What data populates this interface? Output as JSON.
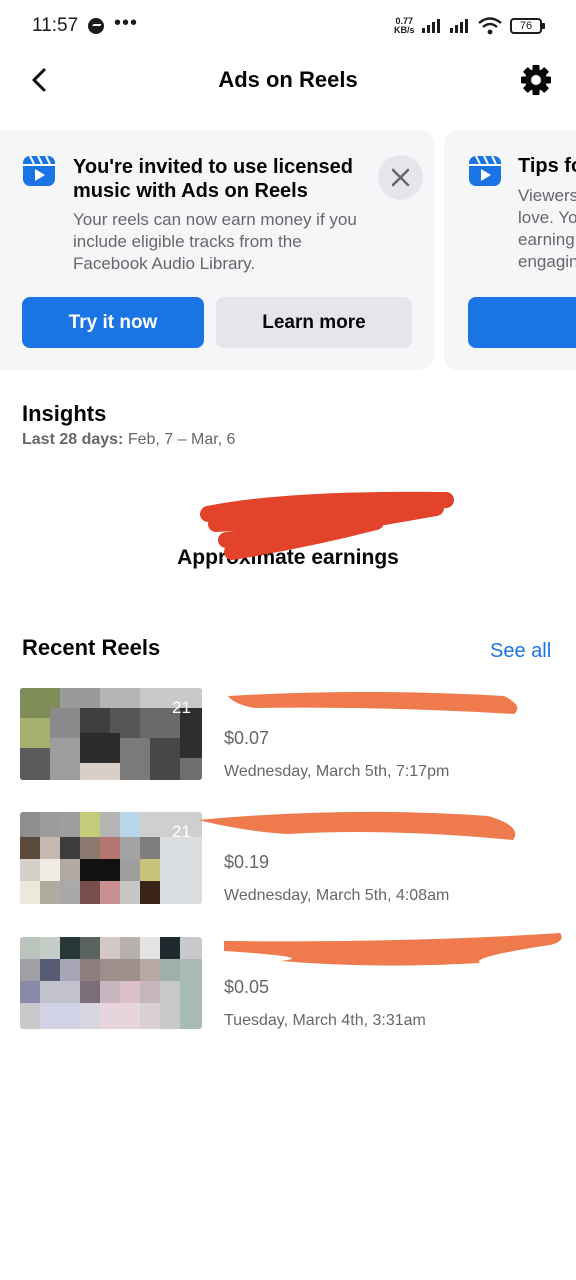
{
  "status_bar": {
    "time": "11:57",
    "dots": "•••",
    "net_speed_value": "0.77",
    "net_speed_unit": "KB/s",
    "battery": "76"
  },
  "header": {
    "title": "Ads on Reels",
    "back_icon": "back-arrow-icon",
    "settings_icon": "gear-icon"
  },
  "promo_cards": [
    {
      "title": "You're invited to use licensed music with Ads on Reels",
      "body": "Your reels can now earn money if you include eligible tracks from the Facebook Audio Library.",
      "primary_label": "Try it now",
      "secondary_label": "Learn more"
    },
    {
      "title": "Tips fo",
      "body_lines": [
        "Viewers",
        "love. Yo",
        "earning",
        "engagin"
      ]
    }
  ],
  "insights": {
    "title": "Insights",
    "range_label": "Last 28 days:",
    "range_value": "Feb, 7 – Mar, 6",
    "earnings_label": "Approximate earnings"
  },
  "recent_reels": {
    "title": "Recent Reels",
    "see_all": "See all",
    "items": [
      {
        "count": "21",
        "earnings": "$0.07",
        "date": "Wednesday, March 5th, 7:17pm"
      },
      {
        "count": "21",
        "earnings": "$0.19",
        "date": "Wednesday, March 5th, 4:08am"
      },
      {
        "count": "",
        "earnings": "$0.05",
        "date": "Tuesday, March 4th, 3:31am"
      }
    ]
  },
  "colors": {
    "accent": "#1b74e4",
    "secondary_text": "#65676b",
    "card_bg": "#f5f6f8",
    "redaction_red": "#e2432a",
    "redaction_orange": "#ee7a4e"
  }
}
